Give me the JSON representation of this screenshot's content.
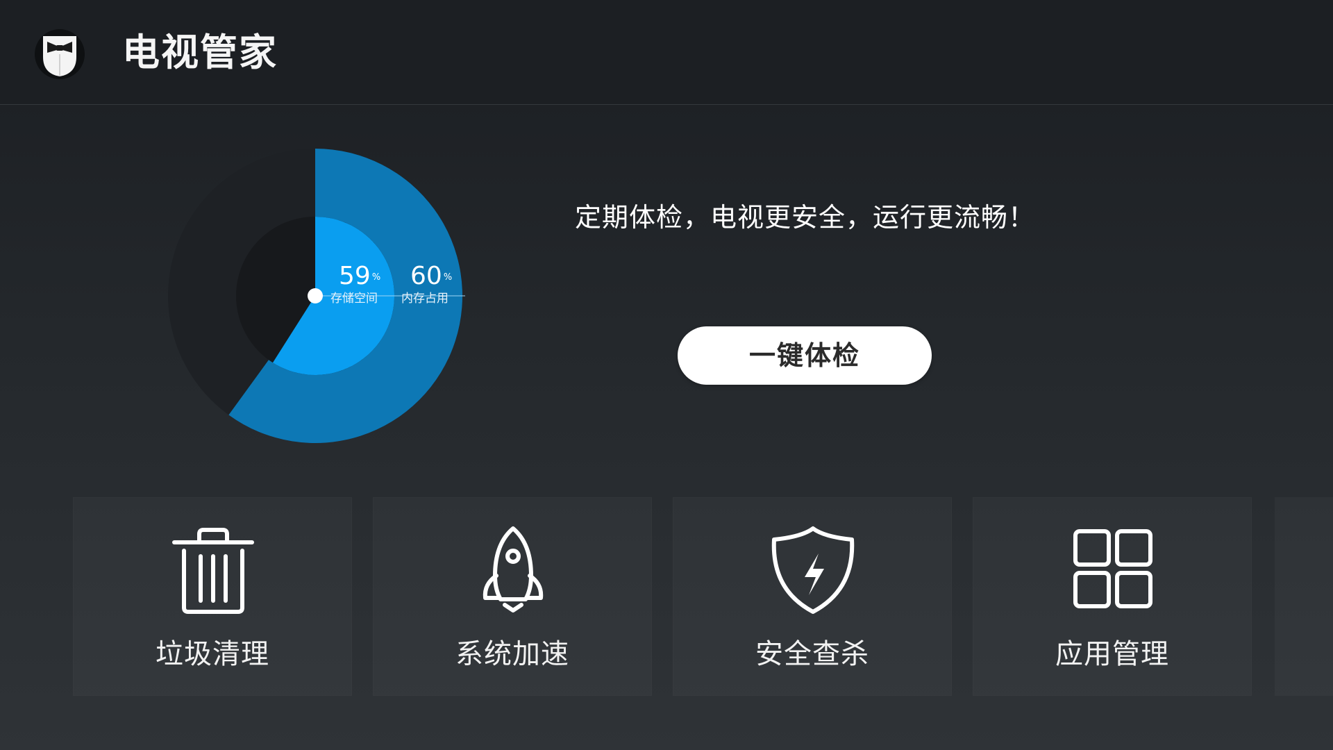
{
  "header": {
    "title": "电视管家",
    "logo_icon": "tuxedo-mask-logo"
  },
  "status": {
    "storage_percent": 59,
    "storage_unit": "%",
    "storage_label": "存储空间",
    "memory_percent": 60,
    "memory_unit": "%",
    "memory_label": "内存占用",
    "colors": {
      "storage": "#0a9ef0",
      "memory": "#0d78b5",
      "track": "#1c1f23"
    }
  },
  "main": {
    "slogan": "定期体检，电视更安全，运行更流畅！",
    "check_button": "一键体检"
  },
  "tiles": [
    {
      "label": "垃圾清理",
      "icon": "trash-icon"
    },
    {
      "label": "系统加速",
      "icon": "rocket-icon"
    },
    {
      "label": "安全查杀",
      "icon": "shield-bolt-icon"
    },
    {
      "label": "应用管理",
      "icon": "apps-grid-icon"
    }
  ]
}
